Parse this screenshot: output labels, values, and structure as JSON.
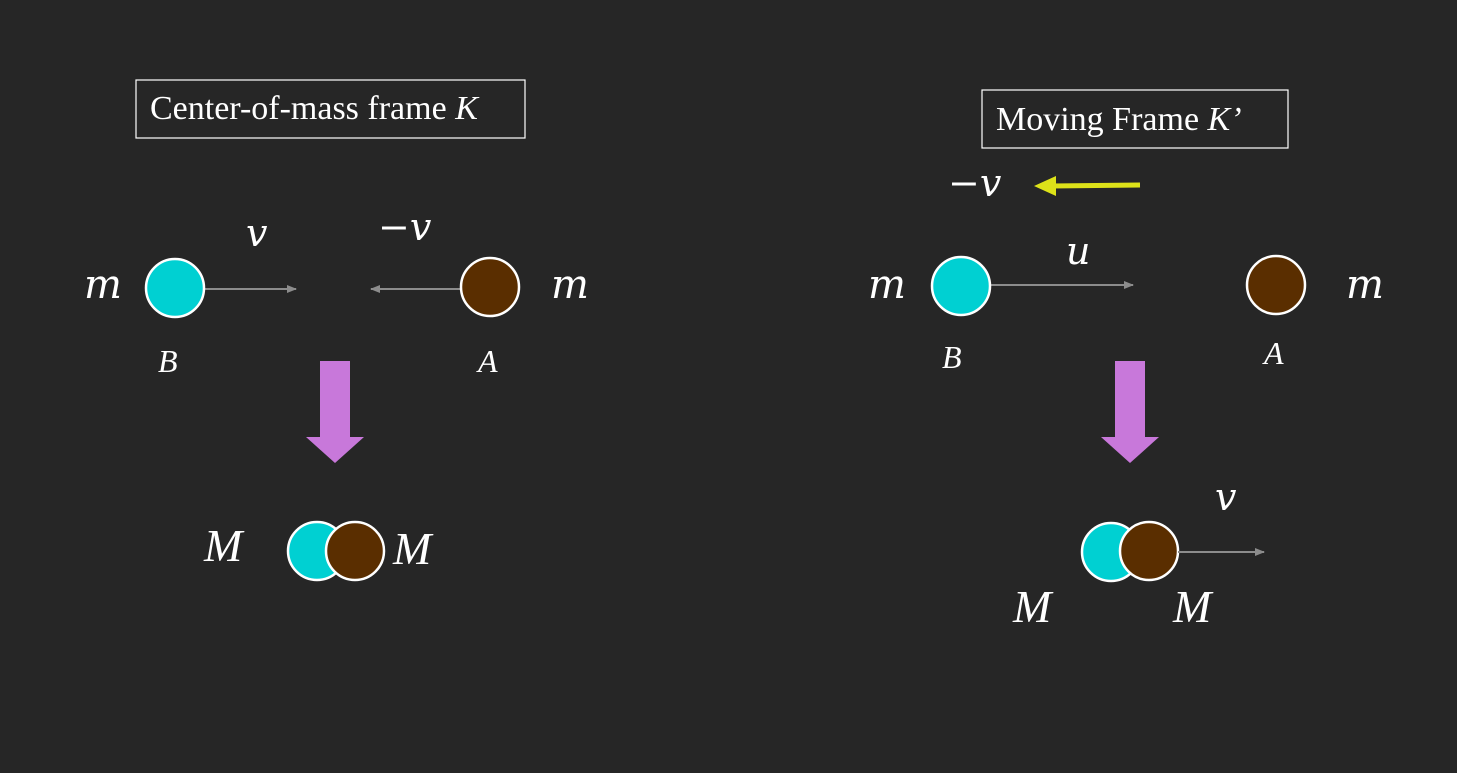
{
  "colors": {
    "background": "#262626",
    "ball_b": "#00d0d2",
    "ball_a": "#5a2e00",
    "transition_arrow": "#c878da",
    "frame_velocity_arrow": "#dde219",
    "velocity_arrow": "#8c8c8c"
  },
  "left_panel": {
    "title_text": "Center-of-mass frame ",
    "title_var": "K",
    "ball_b_mass": "m",
    "ball_b_label": "B",
    "ball_b_velocity": "v",
    "ball_a_mass": "m",
    "ball_a_label": "A",
    "ball_a_velocity": "−v",
    "merged_mass_left": "M",
    "merged_mass_right": "M"
  },
  "right_panel": {
    "title_text": "Moving Frame ",
    "title_var": "K’",
    "frame_velocity": "−v",
    "ball_b_mass": "m",
    "ball_b_label": "B",
    "ball_b_velocity": "u",
    "ball_a_mass": "m",
    "ball_a_label": "A",
    "merged_velocity": "v",
    "merged_mass_left": "M",
    "merged_mass_right": "M"
  }
}
